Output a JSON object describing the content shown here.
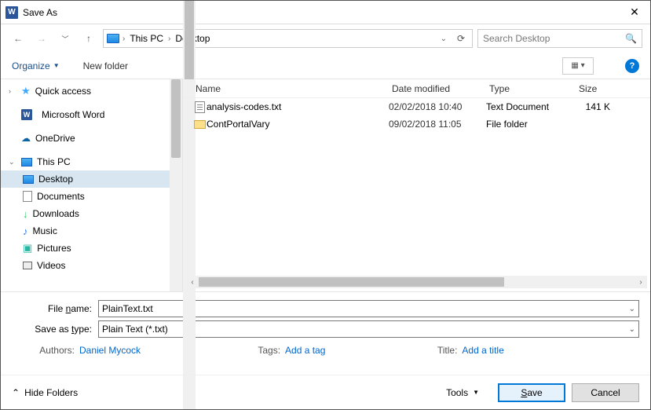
{
  "title": "Save As",
  "nav": {
    "breadcrumb": [
      "This PC",
      "Desktop"
    ],
    "search_placeholder": "Search Desktop"
  },
  "toolbar": {
    "organize": "Organize",
    "new_folder": "New folder"
  },
  "tree": {
    "quick_access": "Quick access",
    "microsoft_word": "Microsoft Word",
    "onedrive": "OneDrive",
    "this_pc": "This PC",
    "desktop": "Desktop",
    "documents": "Documents",
    "downloads": "Downloads",
    "music": "Music",
    "pictures": "Pictures",
    "videos": "Videos"
  },
  "columns": {
    "name": "Name",
    "date": "Date modified",
    "type": "Type",
    "size": "Size"
  },
  "files": [
    {
      "name": "analysis-codes.txt",
      "date": "02/02/2018 10:40",
      "type": "Text Document",
      "size": "141 K",
      "kind": "txt"
    },
    {
      "name": "ContPortalVary",
      "date": "09/02/2018 11:05",
      "type": "File folder",
      "size": "",
      "kind": "folder"
    }
  ],
  "form": {
    "filename_label": "File name:",
    "filename_value": "PlainText.txt",
    "saveastype_label": "Save as type:",
    "saveastype_value": "Plain Text (*.txt)",
    "authors_label": "Authors:",
    "authors_value": "Daniel Mycock",
    "tags_label": "Tags:",
    "tags_value": "Add a tag",
    "title_label": "Title:",
    "title_value": "Add a title"
  },
  "footer": {
    "hide_folders": "Hide Folders",
    "tools": "Tools",
    "save": "Save",
    "cancel": "Cancel"
  }
}
